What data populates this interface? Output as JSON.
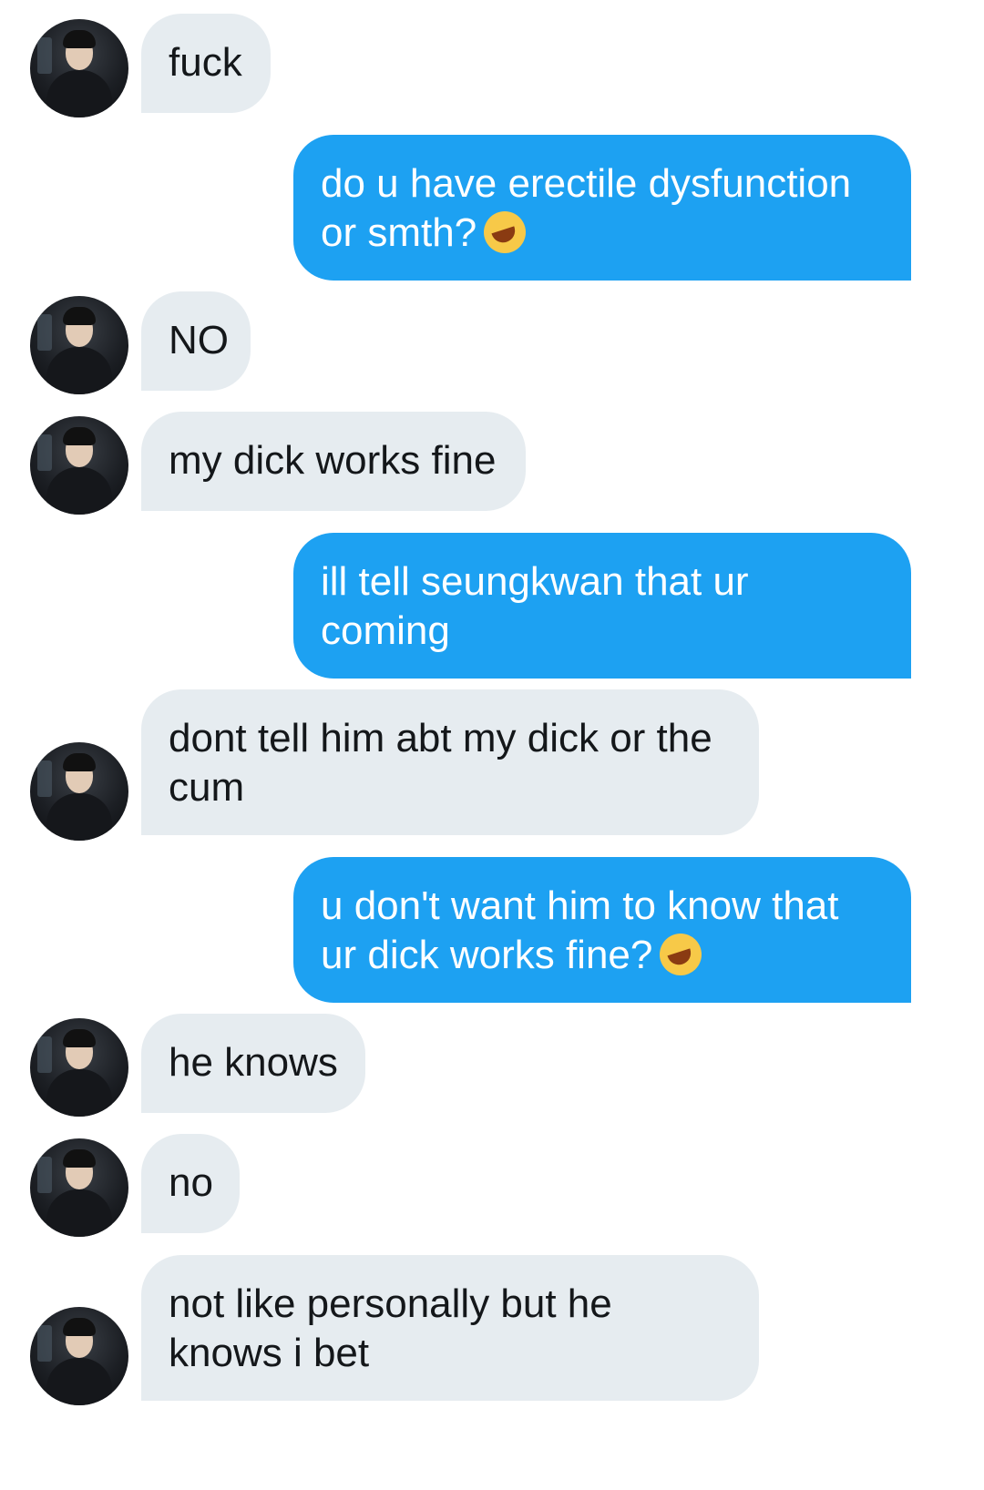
{
  "messages": [
    {
      "side": "in",
      "text": "fuck"
    },
    {
      "side": "out",
      "text": "do u have erectile dysfunction or smth?",
      "emoji": "rolling-on-floor-laughing-emoji"
    },
    {
      "side": "in",
      "text": "NO"
    },
    {
      "side": "in",
      "text": "my dick works fine"
    },
    {
      "side": "out",
      "text": "ill tell seungkwan that ur coming"
    },
    {
      "side": "in",
      "text": "dont tell him abt my dick or the cum"
    },
    {
      "side": "out",
      "text": "u don't want him to know that ur dick works fine?",
      "emoji": "rolling-on-floor-laughing-emoji"
    },
    {
      "side": "in",
      "text": "he knows"
    },
    {
      "side": "in",
      "text": "no"
    },
    {
      "side": "in",
      "text": "not like personally but he knows i bet"
    }
  ],
  "colors": {
    "incoming": "#e6ecf0",
    "outgoing": "#1da1f2"
  }
}
